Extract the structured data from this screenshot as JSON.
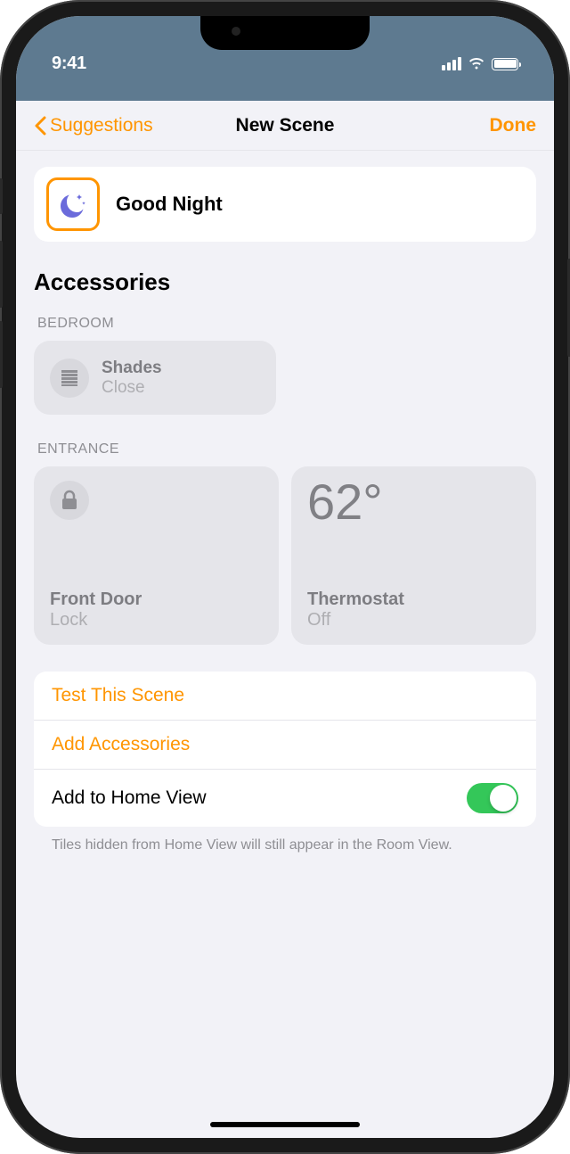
{
  "status": {
    "time": "9:41"
  },
  "nav": {
    "back_label": "Suggestions",
    "title": "New Scene",
    "done_label": "Done"
  },
  "scene": {
    "name": "Good Night",
    "icon": "moon-icon"
  },
  "accessories_header": "Accessories",
  "rooms": [
    {
      "label": "BEDROOM",
      "tiles": [
        {
          "name": "Shades",
          "status": "Close",
          "icon": "shades-icon",
          "size": "small"
        }
      ]
    },
    {
      "label": "ENTRANCE",
      "tiles": [
        {
          "name": "Front Door",
          "status": "Lock",
          "icon": "lock-icon",
          "size": "large"
        },
        {
          "name": "Thermostat",
          "status": "Off",
          "value": "62°",
          "size": "large"
        }
      ]
    }
  ],
  "actions": {
    "test_scene": "Test This Scene",
    "add_accessories": "Add Accessories",
    "add_home_view_label": "Add to Home View",
    "add_home_view_on": true
  },
  "footer_note": "Tiles hidden from Home View will still appear in the Room View.",
  "colors": {
    "accent": "#ff9500",
    "toggle_on": "#34c759"
  }
}
